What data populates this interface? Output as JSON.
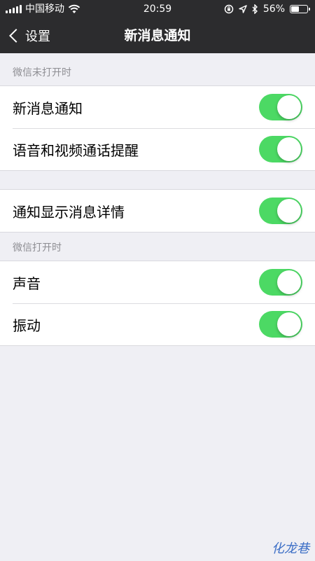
{
  "status_bar": {
    "carrier": "中国移动",
    "time": "20:59",
    "battery_percent": "56%",
    "battery_level": 0.56,
    "icons": [
      "signal-icon",
      "wifi-icon",
      "lock-rotation-icon",
      "location-icon",
      "bluetooth-icon",
      "battery-icon"
    ]
  },
  "nav": {
    "back_label": "设置",
    "title": "新消息通知"
  },
  "sections": [
    {
      "header": "微信未打开时",
      "items": [
        {
          "label": "新消息通知",
          "on": true
        },
        {
          "label": "语音和视频通话提醒",
          "on": true
        }
      ]
    },
    {
      "header": "",
      "items": [
        {
          "label": "通知显示消息详情",
          "on": true
        }
      ]
    },
    {
      "header": "微信打开时",
      "items": [
        {
          "label": "声音",
          "on": true
        },
        {
          "label": "振动",
          "on": true
        }
      ]
    }
  ],
  "watermark": "化龙巷",
  "colors": {
    "toggle_on": "#4cd964",
    "nav_bg": "#2c2c2e",
    "page_bg": "#efeff4"
  }
}
